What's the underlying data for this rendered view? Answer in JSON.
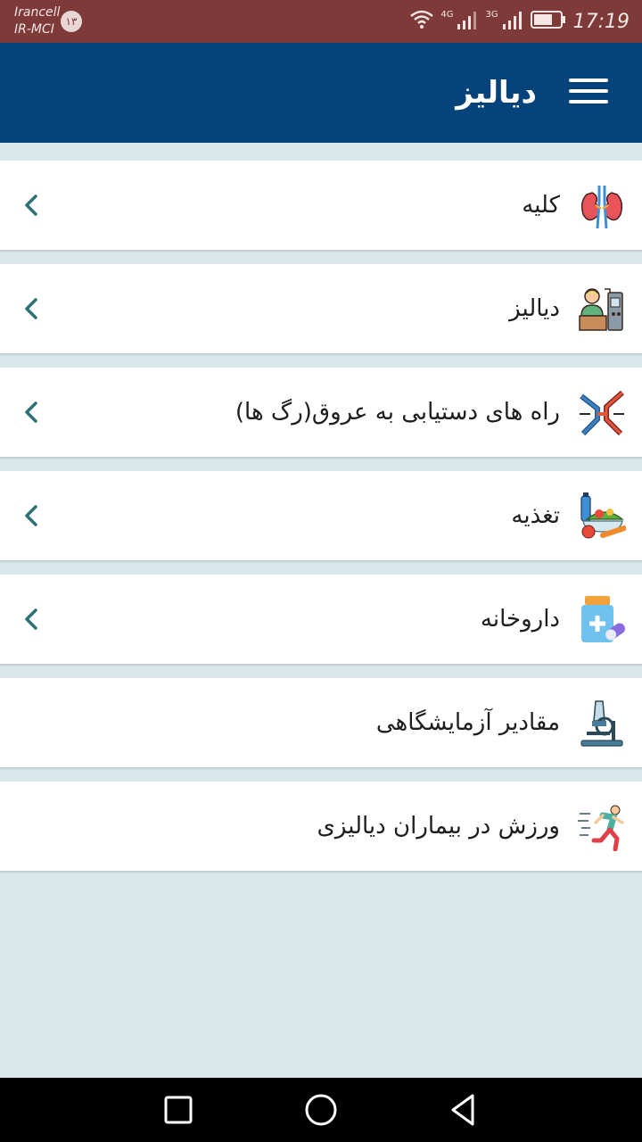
{
  "status_bar": {
    "carrier_line1": "Irancell",
    "carrier_line2": "IR-MCI",
    "notification_count": "۱۳",
    "network_1": "4G",
    "network_2": "3G",
    "time": "17:19"
  },
  "app_bar": {
    "title": "دیالیز",
    "menu_icon": "hamburger-menu-icon"
  },
  "menu_items": [
    {
      "label": "کلیه",
      "icon": "kidney-icon",
      "has_chevron": true
    },
    {
      "label": "دیالیز",
      "icon": "dialysis-patient-icon",
      "has_chevron": true
    },
    {
      "label": "راه های دستیابی به عروق(رگ ها)",
      "icon": "blood-vessel-icon",
      "has_chevron": true
    },
    {
      "label": "تغذیه",
      "icon": "nutrition-icon",
      "has_chevron": true
    },
    {
      "label": "داروخانه",
      "icon": "pharmacy-icon",
      "has_chevron": true
    },
    {
      "label": "مقادیر آزمایشگاهی",
      "icon": "microscope-icon",
      "has_chevron": false
    },
    {
      "label": "ورزش در بیماران دیالیزی",
      "icon": "running-person-icon",
      "has_chevron": false
    }
  ],
  "colors": {
    "status_bar": "#7e3a38",
    "app_bar": "#05437a",
    "background": "#d9e7e9",
    "chevron": "#2f6f77"
  },
  "nav_bar": {
    "recents_icon": "square-recents-icon",
    "home_icon": "circle-home-icon",
    "back_icon": "triangle-back-icon"
  }
}
